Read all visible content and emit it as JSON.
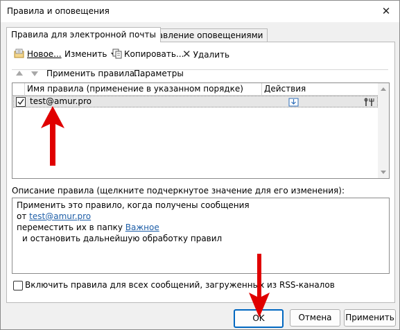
{
  "window": {
    "title": "Правила и оповещения",
    "close_glyph": "✕"
  },
  "tabs": [
    {
      "label": "Правила для электронной почты",
      "active": true
    },
    {
      "label": "Управление оповещениями",
      "active": false
    }
  ],
  "toolbar": {
    "new_label": "Новое...",
    "edit_label": "Изменить",
    "copy_label": "Копировать...",
    "delete_label": "Удалить",
    "apply_label": "Применить правила...",
    "params_label": "Параметры"
  },
  "rules_list": {
    "columns": [
      "Имя правила (применение в указанном порядке)",
      "Действия"
    ],
    "rows": [
      {
        "name": "test@amur.pro",
        "checked": true
      }
    ]
  },
  "description": {
    "label": "Описание правила (щелкните подчеркнутое значение для его изменения):",
    "line1": "Применить это правило, когда получены сообщения",
    "line2_prefix": "от",
    "line2_link": "test@amur.pro",
    "line3_prefix": "переместить их в папку",
    "line3_link": "Важное",
    "line4": "и остановить дальнейшую обработку правил"
  },
  "rss_checkbox": {
    "label": "Включить правила для всех сообщений, загруженных из RSS-каналов",
    "checked": false
  },
  "buttons": {
    "ok": "OK",
    "cancel": "Отмена",
    "apply": "Применить"
  },
  "colors": {
    "accent": "#0067c0",
    "link": "#1f5fa8",
    "annotation_arrow": "#e00000"
  }
}
